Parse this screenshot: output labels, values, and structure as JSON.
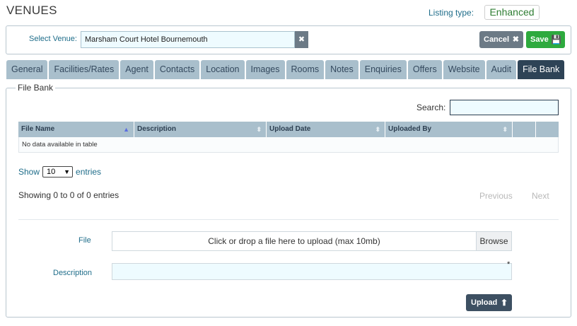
{
  "header": {
    "title": "VENUES",
    "listing_type_label": "Listing type:",
    "listing_type_value": "Enhanced"
  },
  "venue_bar": {
    "label": "Select Venue:",
    "value": "Marsham Court Hotel Bournemouth",
    "clear_icon": "✖",
    "cancel_label": "Cancel",
    "cancel_icon": "✖",
    "save_label": "Save",
    "save_icon": "💾"
  },
  "tabs": [
    {
      "label": "General"
    },
    {
      "label": "Facilities/Rates"
    },
    {
      "label": "Agent"
    },
    {
      "label": "Contacts"
    },
    {
      "label": "Location"
    },
    {
      "label": "Images"
    },
    {
      "label": "Rooms"
    },
    {
      "label": "Notes"
    },
    {
      "label": "Enquiries"
    },
    {
      "label": "Offers"
    },
    {
      "label": "Website"
    },
    {
      "label": "Audit"
    },
    {
      "label": "File Bank",
      "active": true
    }
  ],
  "file_bank": {
    "legend": "File Bank",
    "search_label": "Search:",
    "search_value": "",
    "columns": [
      "File Name",
      "Description",
      "Upload Date",
      "Uploaded By"
    ],
    "empty_message": "No data available in table",
    "show_label": "Show",
    "page_size": "10",
    "entries_label": "entries",
    "info": "Showing 0 to 0 of 0 entries",
    "previous": "Previous",
    "next": "Next"
  },
  "upload_form": {
    "file_label": "File",
    "file_placeholder": "Click or drop a file here to upload (max 10mb)",
    "browse_label": "Browse",
    "description_label": "Description",
    "description_value": "",
    "required_mark": "*",
    "upload_label": "Upload",
    "upload_icon": "⬆"
  },
  "colors": {
    "tab_bg": "#a9bfcc",
    "tab_active_bg": "#2e4356",
    "save_green": "#2eaa3e",
    "cancel_grey": "#6c7a86",
    "label_blue": "#1f6d8a",
    "input_bg": "#eefbff"
  }
}
